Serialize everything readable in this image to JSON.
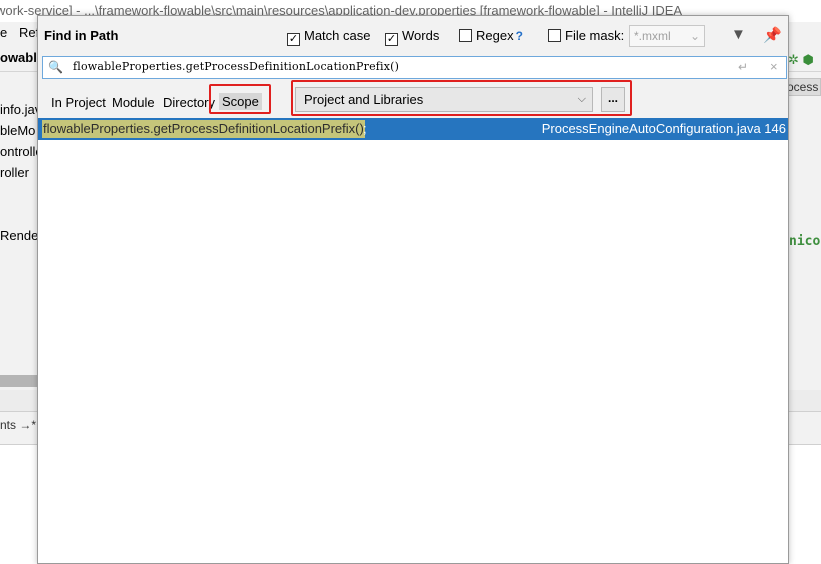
{
  "window": {
    "title": "work-service] - ...\\framework-flowable\\src\\main\\resources\\application-dev.properties [framework-flowable] - IntelliJ IDEA"
  },
  "menu": [
    "e",
    "Ref"
  ],
  "project_tab": "owable",
  "background_tree": [
    "info.jav",
    "bleMo",
    "ontrolle",
    "roller",
    "Rende"
  ],
  "right_tab_label": "ocess",
  "right_code": "nico",
  "lower_tab_label": "nts →*",
  "dialog": {
    "title": "Find in Path",
    "options": {
      "match_case": {
        "label": "Match case",
        "checked": true
      },
      "words": {
        "label": "Words",
        "checked": true
      },
      "regex": {
        "label": "Regex",
        "checked": false,
        "help": "?"
      },
      "file_mask": {
        "label": "File mask:",
        "checked": false,
        "value": "*.mxml"
      }
    },
    "search": {
      "value": "flowableProperties.getProcessDefinitionLocationPrefix()"
    },
    "scope_tabs": [
      "In Project",
      "Module",
      "Directory",
      "Scope"
    ],
    "active_scope_tab": "Scope",
    "scope_select": {
      "value": "Project and Libraries"
    },
    "more_button": "...",
    "results": [
      {
        "match": "flowableProperties.getProcessDefinitionLocationPrefix()",
        "rest": ";",
        "file": "ProcessEngineAutoConfiguration.java 146"
      }
    ]
  },
  "colors": {
    "selection": "#2675bf",
    "highlight": "#c5c57a",
    "annotation": "#e0201f"
  }
}
